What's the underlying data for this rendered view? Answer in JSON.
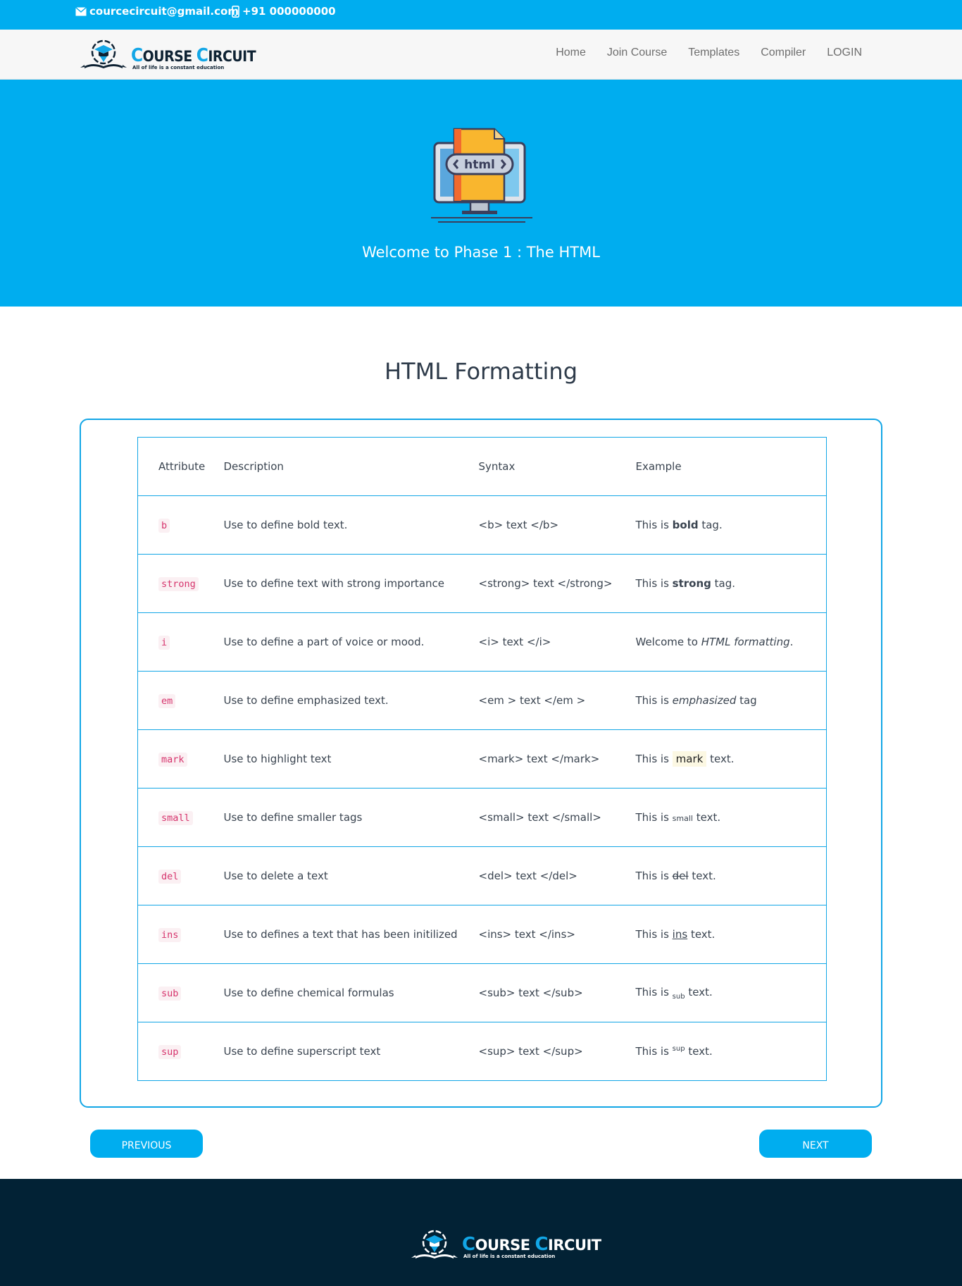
{
  "topbar": {
    "email": "courcecircuit@gmail.com",
    "phone": "+91 000000000",
    "color": "#00adef"
  },
  "brand": {
    "name_first_cap": "C",
    "name_first_rest": "OURSE ",
    "name_second_cap": "C",
    "name_second_rest": "IRCUIT",
    "tagline": "All of life is a constant education"
  },
  "nav": {
    "items": [
      "Home",
      "Join Course",
      "Templates",
      "Compiler",
      "LOGIN"
    ]
  },
  "hero": {
    "icon_text": "html",
    "title": "Welcome to Phase 1 : The HTML"
  },
  "section": {
    "title": "HTML Formatting"
  },
  "table": {
    "headers": [
      "Attribute",
      "Description",
      "Syntax",
      "Example"
    ],
    "rows": [
      {
        "attr": "b",
        "desc": "Use to define bold text.",
        "syntax": "<b> text </b>",
        "ex_pre": "This is ",
        "ex_mid": "bold",
        "ex_post": " tag."
      },
      {
        "attr": "strong",
        "desc": "Use to define text with strong importance",
        "syntax": "<strong> text </strong>",
        "ex_pre": "This is ",
        "ex_mid": "strong",
        "ex_post": " tag."
      },
      {
        "attr": "i",
        "desc": "Use to define a part of voice or mood.",
        "syntax": "<i> text </i>",
        "ex_pre": "Welcome to ",
        "ex_mid": "HTML formatting",
        "ex_post": "."
      },
      {
        "attr": "em",
        "desc": "Use to define emphasized text.",
        "syntax": "<em > text </em >",
        "ex_pre": "This is ",
        "ex_mid": "emphasized",
        "ex_post": " tag"
      },
      {
        "attr": "mark",
        "desc": "Use to highlight text",
        "syntax": "<mark> text </mark>",
        "ex_pre": "This is ",
        "ex_mid": "mark",
        "ex_post": " text."
      },
      {
        "attr": "small",
        "desc": "Use to define smaller tags",
        "syntax": "<small> text </small>",
        "ex_pre": "This is ",
        "ex_mid": "small",
        "ex_post": " text."
      },
      {
        "attr": "del",
        "desc": "Use to delete a text",
        "syntax": "<del> text </del>",
        "ex_pre": "This is ",
        "ex_mid": "del",
        "ex_post": " text."
      },
      {
        "attr": "ins",
        "desc": "Use to defines a text that has been initilized",
        "syntax": "<ins> text </ins>",
        "ex_pre": "This is ",
        "ex_mid": "ins",
        "ex_post": " text."
      },
      {
        "attr": "sub",
        "desc": "Use to define chemical formulas",
        "syntax": "<sub> text </sub>",
        "ex_pre": "This is ",
        "ex_mid": "sub",
        "ex_post": " text."
      },
      {
        "attr": "sup",
        "desc": "Use to define superscript text",
        "syntax": "<sup> text </sup>",
        "ex_pre": "This is ",
        "ex_mid": "sup",
        "ex_post": " text."
      }
    ]
  },
  "buttons": {
    "previous": "PREVIOUS",
    "next": "NEXT"
  },
  "colors": {
    "accent": "#00adef",
    "footer": "#022235"
  },
  "icons": {
    "email": "envelope-icon",
    "phone": "mobile-phone-icon",
    "hero": "html-monitor-icon"
  }
}
